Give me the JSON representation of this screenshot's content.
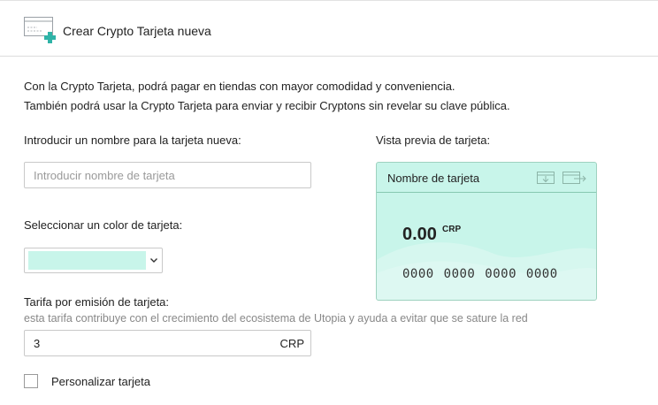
{
  "header": {
    "title": "Crear Crypto Tarjeta nueva",
    "icon": "new-card-icon",
    "accent_color": "#2fb3a7"
  },
  "intro": {
    "line1": "Con la Crypto Tarjeta, podrá pagar en tiendas con mayor comodidad y conveniencia.",
    "line2": "También podrá usar la Crypto Tarjeta para enviar y recibir Cryptons sin revelar su clave pública."
  },
  "form": {
    "name_label": "Introducir un nombre para la tarjeta nueva:",
    "name_value": "",
    "name_placeholder": "Introducir nombre de tarjeta",
    "color_label": "Seleccionar un color de tarjeta:",
    "selected_color": "#c8f5ea",
    "fee_label": "Tarifa por emisión de tarjeta:",
    "fee_note": "esta tarifa contribuye con el crecimiento del ecosistema de Utopia y ayuda a evitar que se sature la red",
    "fee_value": "3",
    "fee_unit": "CRP",
    "customize_label": "Personalizar tarjeta",
    "customize_checked": false
  },
  "preview": {
    "label": "Vista previa de tarjeta:",
    "card_name": "Nombre de tarjeta",
    "amount": "0.00",
    "currency": "CRP",
    "number": "0000 0000 0000 0000",
    "card_color": "#c8f5ea",
    "icons": [
      "card-receive-icon",
      "card-send-icon"
    ]
  }
}
